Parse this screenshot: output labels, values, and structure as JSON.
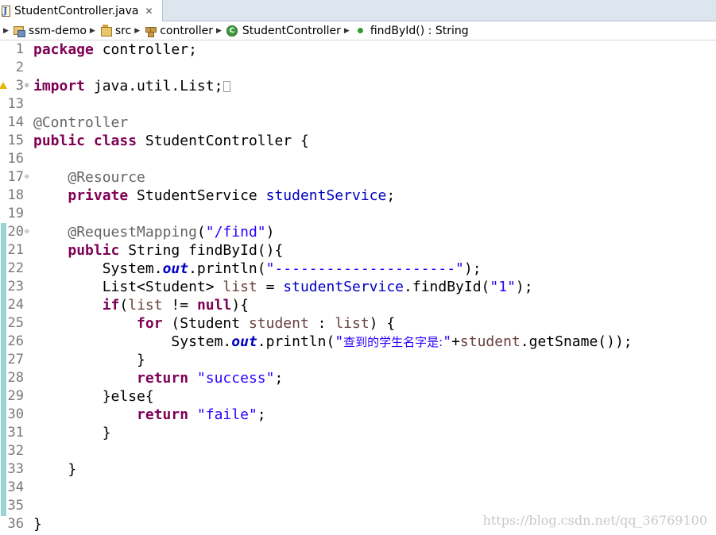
{
  "tab": {
    "title": "StudentController.java",
    "close_glyph": "✕"
  },
  "breadcrumb": [
    {
      "label": "ssm-demo",
      "icon": "project-icon"
    },
    {
      "label": "src",
      "icon": "source-folder-icon"
    },
    {
      "label": "controller",
      "icon": "package-icon"
    },
    {
      "label": "StudentController",
      "icon": "class-icon"
    },
    {
      "label": "findById() : String",
      "icon": "method-icon"
    }
  ],
  "code": {
    "lines": [
      {
        "n": "1",
        "tokens": [
          [
            "kw",
            "package"
          ],
          [
            "plain",
            " controller;"
          ]
        ]
      },
      {
        "n": "2",
        "tokens": []
      },
      {
        "n": "3",
        "marker": "⊕",
        "warning": true,
        "tokens": [
          [
            "kw",
            "import"
          ],
          [
            "plain",
            " java.util.List;"
          ]
        ],
        "collapsed": true
      },
      {
        "n": "13",
        "tokens": []
      },
      {
        "n": "14",
        "tokens": [
          [
            "ann",
            "@Controller"
          ]
        ]
      },
      {
        "n": "15",
        "tokens": [
          [
            "kw",
            "public"
          ],
          [
            "plain",
            " "
          ],
          [
            "kw",
            "class"
          ],
          [
            "plain",
            " StudentController {"
          ]
        ]
      },
      {
        "n": "16",
        "tokens": []
      },
      {
        "n": "17",
        "marker": "⊖",
        "tokens": [
          [
            "plain",
            "    "
          ],
          [
            "ann",
            "@Resource"
          ]
        ]
      },
      {
        "n": "18",
        "tokens": [
          [
            "plain",
            "    "
          ],
          [
            "kw",
            "private"
          ],
          [
            "plain",
            " StudentService "
          ],
          [
            "fld",
            "studentService"
          ],
          [
            "plain",
            ";"
          ]
        ]
      },
      {
        "n": "19",
        "tokens": []
      },
      {
        "n": "20",
        "marker": "⊖",
        "tokens": [
          [
            "plain",
            "    "
          ],
          [
            "ann",
            "@RequestMapping"
          ],
          [
            "plain",
            "("
          ],
          [
            "str",
            "\"/find\""
          ],
          [
            "plain",
            ")"
          ]
        ]
      },
      {
        "n": "21",
        "tokens": [
          [
            "plain",
            "    "
          ],
          [
            "kw",
            "public"
          ],
          [
            "plain",
            " String findById(){"
          ]
        ]
      },
      {
        "n": "22",
        "tokens": [
          [
            "plain",
            "        System."
          ],
          [
            "sfld",
            "out"
          ],
          [
            "plain",
            ".println("
          ],
          [
            "str",
            "\"---------------------\""
          ],
          [
            "plain",
            ");"
          ]
        ]
      },
      {
        "n": "23",
        "tokens": [
          [
            "plain",
            "        List<Student> "
          ],
          [
            "var",
            "list"
          ],
          [
            "plain",
            " = "
          ],
          [
            "fld",
            "studentService"
          ],
          [
            "plain",
            ".findById("
          ],
          [
            "str",
            "\"1\""
          ],
          [
            "plain",
            ");"
          ]
        ]
      },
      {
        "n": "24",
        "tokens": [
          [
            "plain",
            "        "
          ],
          [
            "kw",
            "if"
          ],
          [
            "plain",
            "("
          ],
          [
            "var",
            "list"
          ],
          [
            "plain",
            " != "
          ],
          [
            "kw",
            "null"
          ],
          [
            "plain",
            "){"
          ]
        ]
      },
      {
        "n": "25",
        "tokens": [
          [
            "plain",
            "            "
          ],
          [
            "kw",
            "for"
          ],
          [
            "plain",
            " (Student "
          ],
          [
            "var",
            "student"
          ],
          [
            "plain",
            " : "
          ],
          [
            "var",
            "list"
          ],
          [
            "plain",
            ") {"
          ]
        ]
      },
      {
        "n": "26",
        "tokens": [
          [
            "plain",
            "                System."
          ],
          [
            "sfld",
            "out"
          ],
          [
            "plain",
            ".println("
          ],
          [
            "str",
            "\""
          ],
          [
            "strcjk",
            "查到的学生名字是:"
          ],
          [
            "str",
            "\""
          ],
          [
            "plain",
            "+"
          ],
          [
            "var",
            "student"
          ],
          [
            "plain",
            ".getSname());"
          ]
        ]
      },
      {
        "n": "27",
        "tokens": [
          [
            "plain",
            "            }"
          ]
        ]
      },
      {
        "n": "28",
        "tokens": [
          [
            "plain",
            "            "
          ],
          [
            "kw",
            "return"
          ],
          [
            "plain",
            " "
          ],
          [
            "str",
            "\"success\""
          ],
          [
            "plain",
            ";"
          ]
        ]
      },
      {
        "n": "29",
        "tokens": [
          [
            "plain",
            "        }else{"
          ]
        ]
      },
      {
        "n": "30",
        "tokens": [
          [
            "plain",
            "            "
          ],
          [
            "kw",
            "return"
          ],
          [
            "plain",
            " "
          ],
          [
            "str",
            "\"faile\""
          ],
          [
            "plain",
            ";"
          ]
        ]
      },
      {
        "n": "31",
        "tokens": [
          [
            "plain",
            "        }"
          ]
        ]
      },
      {
        "n": "32",
        "tokens": []
      },
      {
        "n": "33",
        "tokens": [
          [
            "plain",
            "    }"
          ]
        ]
      },
      {
        "n": "34",
        "tokens": []
      },
      {
        "n": "35",
        "tokens": []
      },
      {
        "n": "36",
        "tokens": [
          [
            "plain",
            "}"
          ]
        ]
      }
    ]
  },
  "watermark": "https://blog.csdn.net/qq_36769100",
  "colors": {
    "keyword": "#7f0055",
    "annotation": "#646464",
    "string": "#2a00ff",
    "field": "#0000c0",
    "local_variable": "#6a3e3e",
    "change_bar": "#9ad4d4"
  }
}
